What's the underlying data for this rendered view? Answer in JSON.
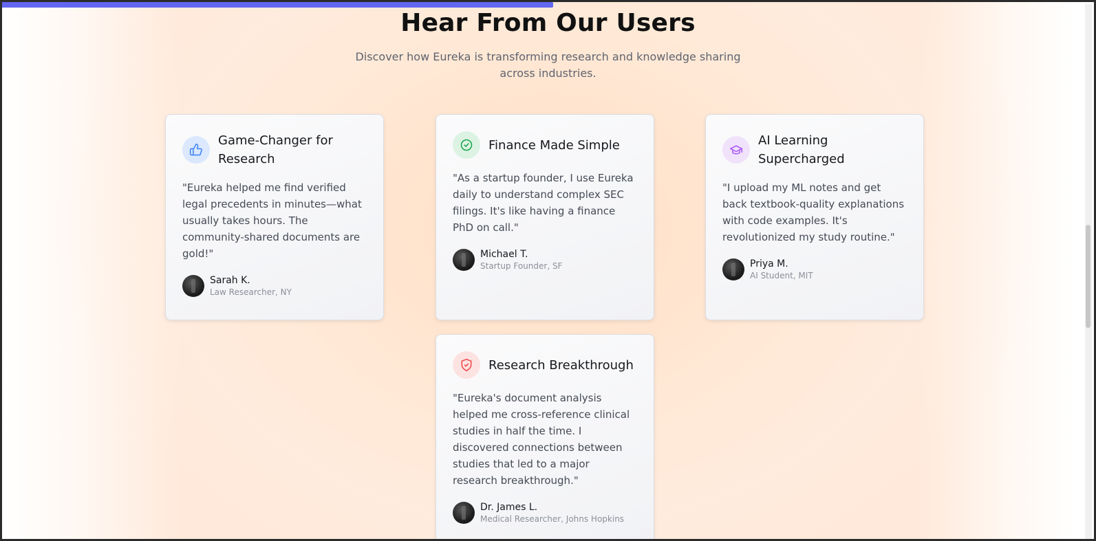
{
  "progress": {
    "percent": 50.5,
    "color": "#6366f1"
  },
  "section": {
    "title": "Hear From Our Users",
    "subtitle": "Discover how Eureka is transforming research and knowledge sharing across industries."
  },
  "testimonials": [
    {
      "title": "Game-Changer for Research",
      "icon": "thumbs-up-icon",
      "icon_color": "#3b82f6",
      "icon_bg": "#dbe8fd",
      "quote": "\"Eureka helped me find verified legal precedents in minutes—what usually takes hours. The community-shared documents are gold!\"",
      "name": "Sarah K.",
      "role": "Law Researcher, NY"
    },
    {
      "title": "Finance Made Simple",
      "icon": "check-circle-icon",
      "icon_color": "#16a34a",
      "icon_bg": "#dcf3e3",
      "quote": "\"As a startup founder, I use Eureka daily to understand complex SEC filings. It's like having a finance PhD on call.\"",
      "name": "Michael T.",
      "role": "Startup Founder, SF"
    },
    {
      "title": "AI Learning Supercharged",
      "icon": "graduation-cap-icon",
      "icon_color": "#a855f7",
      "icon_bg": "#f1e2fb",
      "quote": "\"I upload my ML notes and get back textbook-quality explanations with code examples. It's revolutionized my study routine.\"",
      "name": "Priya M.",
      "role": "AI Student, MIT"
    },
    {
      "title": "Research Breakthrough",
      "icon": "shield-check-icon",
      "icon_color": "#ef4444",
      "icon_bg": "#fde2e2",
      "quote": "\"Eureka's document analysis helped me cross-reference clinical studies in half the time. I discovered connections between studies that led to a major research breakthrough.\"",
      "name": "Dr. James L.",
      "role": "Medical Researcher, Johns Hopkins"
    }
  ]
}
